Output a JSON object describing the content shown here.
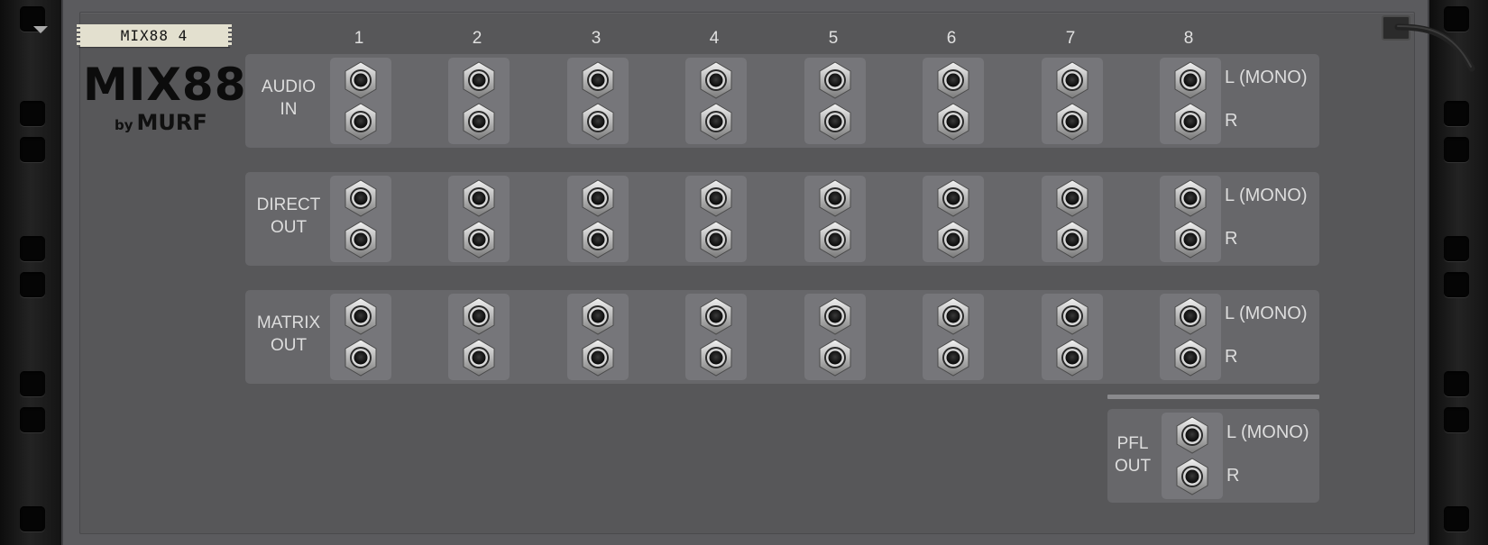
{
  "device": {
    "tape_label": "MIX88 4",
    "logo": "MIX88",
    "by": "by",
    "maker": "MURF"
  },
  "columns": [
    "1",
    "2",
    "3",
    "4",
    "5",
    "6",
    "7",
    "8"
  ],
  "groups": [
    {
      "id": "audio-in",
      "label_line1": "AUDIO",
      "label_line2": "IN",
      "left_label": "L (MONO)",
      "right_label": "R"
    },
    {
      "id": "direct-out",
      "label_line1": "DIRECT",
      "label_line2": "OUT",
      "left_label": "L (MONO)",
      "right_label": "R"
    },
    {
      "id": "matrix-out",
      "label_line1": "MATRIX",
      "label_line2": "OUT",
      "left_label": "L (MONO)",
      "right_label": "R"
    }
  ],
  "pfl": {
    "label_line1": "PFL",
    "label_line2": "OUT",
    "left_label": "L (MONO)",
    "right_label": "R"
  },
  "icons": {
    "jack": "audio-jack-icon",
    "cable": "cable-plug-icon",
    "fold": "fold-arrow-icon"
  },
  "colors": {
    "panel": "#5b5b5e",
    "group": "#67676a",
    "pad": "#76767a",
    "text": "#dddddd",
    "tape": "#e3e0cf"
  }
}
